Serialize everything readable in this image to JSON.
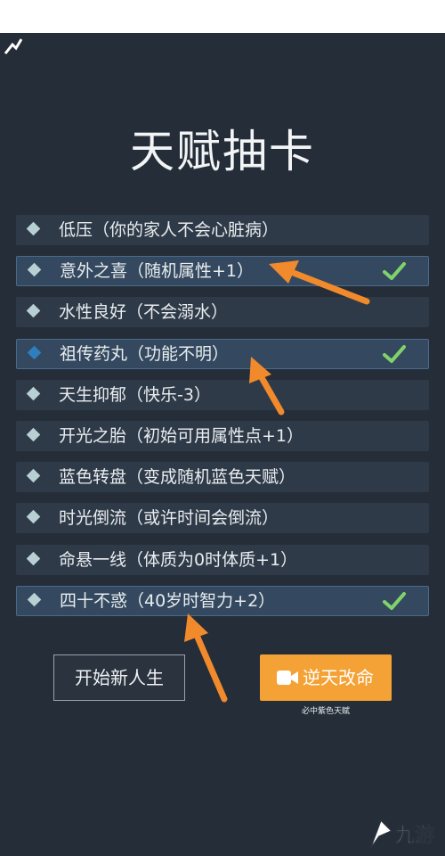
{
  "title": "天赋抽卡",
  "talents": [
    {
      "label": "低压（你的家人不会心脏病）",
      "selected": false
    },
    {
      "label": "意外之喜（随机属性+1）",
      "selected": true
    },
    {
      "label": "水性良好（不会溺水）",
      "selected": false
    },
    {
      "label": "祖传药丸（功能不明）",
      "selected": true
    },
    {
      "label": "天生抑郁（快乐-3）",
      "selected": false
    },
    {
      "label": "开光之胎（初始可用属性点+1）",
      "selected": false
    },
    {
      "label": "蓝色转盘（变成随机蓝色天赋）",
      "selected": false
    },
    {
      "label": "时光倒流（或许时间会倒流）",
      "selected": false
    },
    {
      "label": "命悬一线（体质为0时体质+1）",
      "selected": false
    },
    {
      "label": "四十不惑（40岁时智力+2）",
      "selected": true
    }
  ],
  "buttons": {
    "start_label": "开始新人生",
    "gold_label": "逆天改命",
    "gold_sub": "必中紫色天赋"
  },
  "watermark": {
    "text": "九游"
  },
  "colors": {
    "background": "#242d38",
    "accent": "#f4a236",
    "check": "#7fd36a",
    "arrow": "#f08a2c"
  },
  "icons": [
    "check-icon",
    "diamond-bullet-icon",
    "video-icon",
    "arrow-annotation"
  ]
}
